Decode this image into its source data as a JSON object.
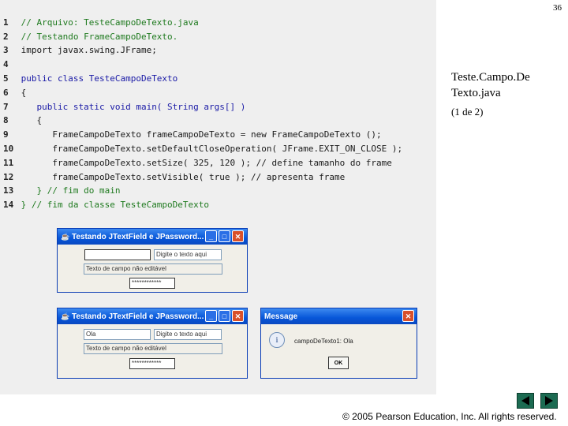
{
  "slide": {
    "page_number": "36",
    "title": "Teste.Campo.De Texto.java",
    "title_line1": "Teste.Campo.De",
    "title_line2": "Texto.java",
    "part": "(1 de 2)",
    "copyright": "© 2005 Pearson Education, Inc.  All rights reserved."
  },
  "code": {
    "lines": [
      {
        "n": "1",
        "text": "// Arquivo: TesteCampoDeTexto.java"
      },
      {
        "n": "2",
        "text": "// Testando FrameCampoDeTexto."
      },
      {
        "n": "3",
        "text": "import javax.swing.JFrame;"
      },
      {
        "n": "4",
        "text": ""
      },
      {
        "n": "5",
        "text": "public class TesteCampoDeTexto"
      },
      {
        "n": "6",
        "text": "{"
      },
      {
        "n": "7",
        "text": "   public static void main( String args[] )"
      },
      {
        "n": "8",
        "text": "   {"
      },
      {
        "n": "9",
        "text": "      FrameCampoDeTexto frameCampoDeTexto = new FrameCampoDeTexto ();"
      },
      {
        "n": "10",
        "text": "      frameCampoDeTexto.setDefaultCloseOperation( JFrame.EXIT_ON_CLOSE );"
      },
      {
        "n": "11",
        "text": "      frameCampoDeTexto.setSize( 325, 120 ); // define tamanho do frame"
      },
      {
        "n": "12",
        "text": "      frameCampoDeTexto.setVisible( true ); // apresenta frame"
      },
      {
        "n": "13",
        "text": "   } // fim do main"
      },
      {
        "n": "14",
        "text": "} // fim da classe TesteCampoDeTexto"
      }
    ]
  },
  "window1": {
    "title": "Testando JTextField e JPassword...",
    "field1_value": "",
    "field2_value": "Digite o texto aqui",
    "field3_value": "Texto de campo não editável",
    "password_value": "************"
  },
  "window2": {
    "title": "Testando JTextField e JPassword...",
    "field1_value": "Ola",
    "field2_value": "Digite o texto aqui",
    "field3_value": "Texto de campo não editável",
    "password_value": "************"
  },
  "message": {
    "title": "Message",
    "text": "campoDeTexto1: Ola",
    "ok_label": "OK",
    "icon": "i"
  },
  "icons": {
    "min": "_",
    "max": "□",
    "close": "✕"
  },
  "colors": {
    "titlebar": "#0756d8",
    "nav": "#1c6b52"
  }
}
